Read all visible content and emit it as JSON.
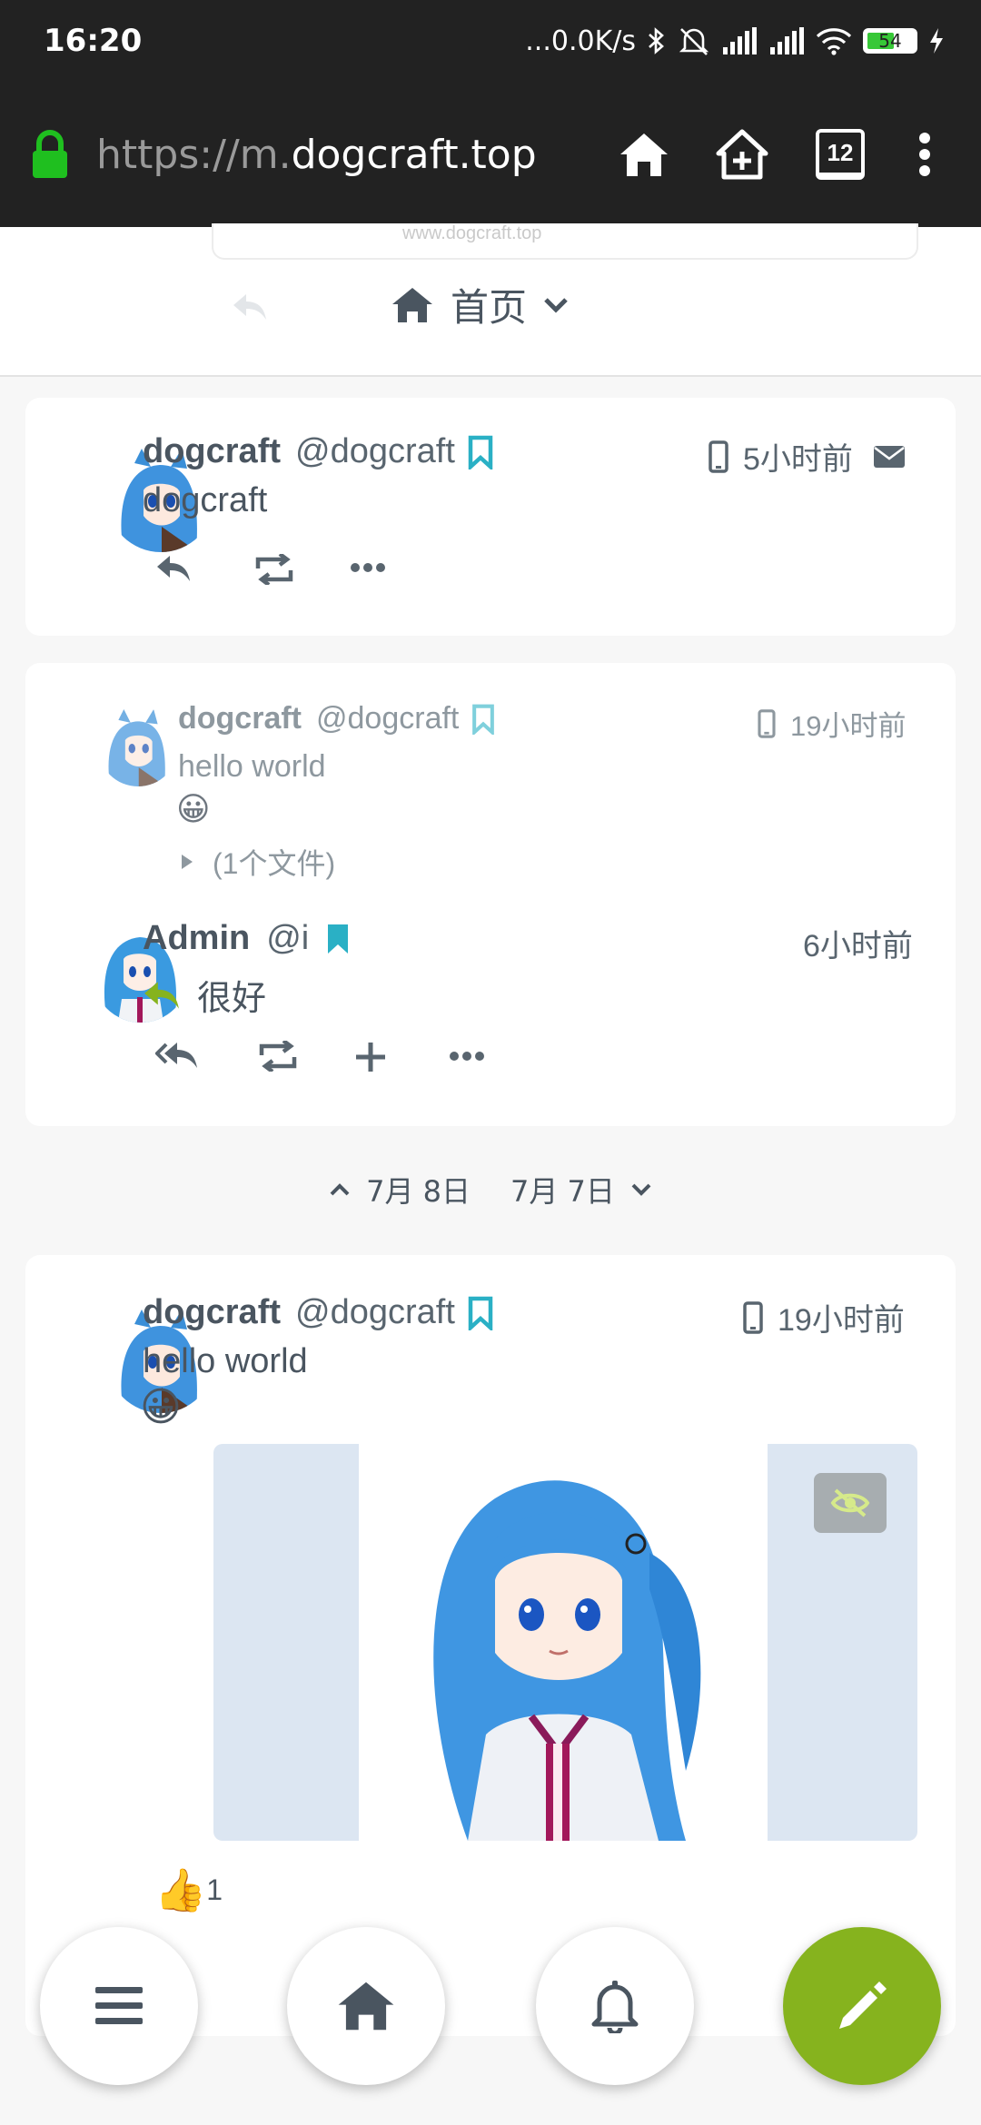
{
  "status_bar": {
    "time": "16:20",
    "net_speed": "...0.0K/s",
    "battery": "54"
  },
  "browser": {
    "url_scheme": "https://m.",
    "url_host": "dogcraft.top",
    "tab_count": "12"
  },
  "top": {
    "stub_text": "www.dogcraft.top",
    "page_title": "首页"
  },
  "posts": [
    {
      "name": "dogcraft",
      "handle": "@dogcraft",
      "time": "5小时前",
      "text": "dogcraft"
    },
    {
      "quoted": {
        "name": "dogcraft",
        "handle": "@dogcraft",
        "time": "19小时前",
        "text": "hello world",
        "emoji": "😀",
        "attachment": "(1个文件)"
      },
      "reply": {
        "name": "Admin",
        "handle": "@i",
        "time": "6小时前",
        "text": "很好"
      }
    },
    {
      "name": "dogcraft",
      "handle": "@dogcraft",
      "time": "19小时前",
      "text": "hello world",
      "emoji": "😀",
      "reaction_emoji": "👍",
      "reaction_count": "1"
    }
  ],
  "date_nav": {
    "prev": "7月 8日",
    "next": "7月 7日"
  },
  "colors": {
    "accent": "#86b31e",
    "bookmark": "#2ab0c5",
    "text": "#4a5560"
  }
}
